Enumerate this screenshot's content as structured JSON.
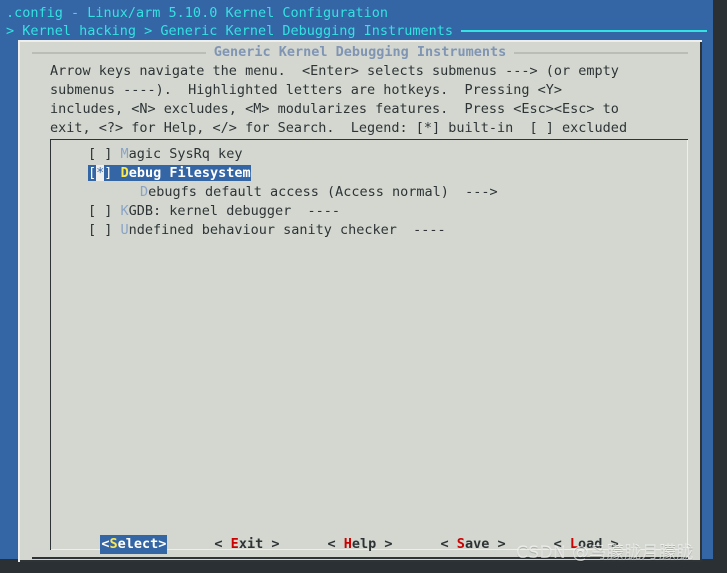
{
  "header": {
    "title": ".config - Linux/arm 5.10.0 Kernel Configuration",
    "breadcrumb": "> Kernel hacking > Generic Kernel Debugging Instruments"
  },
  "dialog": {
    "title": "Generic Kernel Debugging Instruments",
    "help_lines": [
      "Arrow keys navigate the menu.  <Enter> selects submenus ---> (or empty",
      "submenus ----).  Highlighted letters are hotkeys.  Pressing <Y>",
      "includes, <N> excludes, <M> modularizes features.  Press <Esc><Esc> to",
      "exit, <?> for Help, </> for Search.  Legend: [*] built-in  [ ] excluded"
    ]
  },
  "menu": {
    "items": [
      {
        "checkbox": "[ ]",
        "hotkey": "M",
        "text": "agic SysRq key",
        "selected": false,
        "sub": false
      },
      {
        "checkbox": "[*]",
        "hotkey": "D",
        "text": "ebug Filesystem",
        "selected": true,
        "sub": false
      },
      {
        "checkbox": "",
        "hotkey": "D",
        "text": "ebugfs default access (Access normal)  --->",
        "selected": false,
        "sub": true
      },
      {
        "checkbox": "[ ]",
        "hotkey": "K",
        "text": "GDB: kernel debugger  ----",
        "selected": false,
        "sub": false
      },
      {
        "checkbox": "[ ]",
        "hotkey": "U",
        "text": "ndefined behaviour sanity checker  ----",
        "selected": false,
        "sub": false
      }
    ]
  },
  "buttons": [
    {
      "prefix": "<",
      "hot": "S",
      "rest": "elect>",
      "suffix": "",
      "active": true
    },
    {
      "prefix": "< ",
      "hot": "E",
      "rest": "xit",
      "suffix": " >",
      "active": false
    },
    {
      "prefix": "< ",
      "hot": "H",
      "rest": "elp",
      "suffix": " >",
      "active": false
    },
    {
      "prefix": "< ",
      "hot": "S",
      "rest": "ave",
      "suffix": " >",
      "active": false
    },
    {
      "prefix": "< ",
      "hot": "L",
      "rest": "oad",
      "suffix": " >",
      "active": false
    }
  ],
  "watermark": "CSDN @鸟朦胧月朦胧",
  "colors": {
    "terminal_bg": "#2b3035",
    "backdrop_blue": "#3465a4",
    "dialog_bg": "#d3d7cf",
    "header_cyan": "#34e2e2",
    "title_blue": "#8094b4",
    "text_dark": "#2e3436",
    "hotkey_blue": "#8aa3c4",
    "hotkey_yellow": "#fce94f",
    "hotkey_red": "#cc0000"
  }
}
